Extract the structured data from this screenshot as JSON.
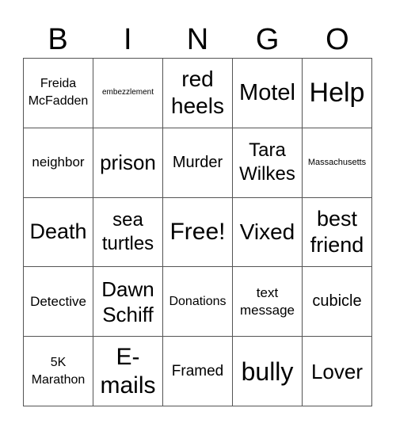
{
  "header": {
    "letters": [
      "B",
      "I",
      "N",
      "G",
      "O"
    ]
  },
  "card": {
    "rows": [
      [
        "Freida McFadden",
        "embezzlement",
        "red heels",
        "Motel",
        "Help"
      ],
      [
        "neighbor",
        "prison",
        "Murder",
        "Tara Wilkes",
        "Massachusetts"
      ],
      [
        "Death",
        "sea turtles",
        "Free!",
        "Vixed",
        "best friend"
      ],
      [
        "Detective",
        "Dawn Schiff",
        "Donations",
        "text message",
        "cubicle"
      ],
      [
        "5K Marathon",
        "E-mails",
        "Framed",
        "bully",
        "Lover"
      ]
    ]
  }
}
